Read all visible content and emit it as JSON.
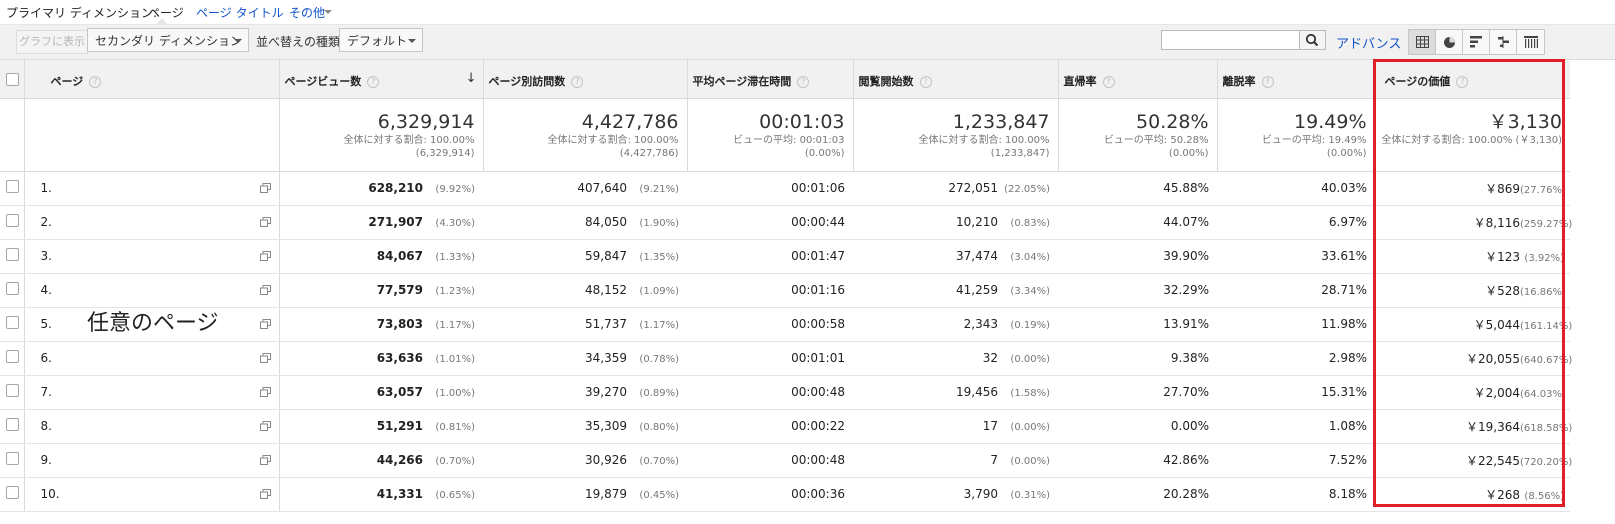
{
  "dimension_bar": {
    "label": "プライマリ ディメンション:",
    "current": "ページ",
    "links": [
      "ページ タイトル",
      "その他"
    ]
  },
  "toolbar": {
    "graph_button": "グラフに表示",
    "secondary_dimension": "セカンダリ ディメンション",
    "sort_label": "並べ替えの種類:",
    "sort_value": "デフォルト",
    "search_value": "",
    "advanced": "アドバンス",
    "view_buttons": [
      "table-view-icon",
      "pie-view-icon",
      "performance-view-icon",
      "comparison-view-icon",
      "pivot-view-icon"
    ]
  },
  "table": {
    "headers": {
      "page": "ページ",
      "pageviews": "ページビュー数",
      "unique": "ページ別訪問数",
      "avg_time": "平均ページ滞在時間",
      "entrances": "閲覧開始数",
      "bounce": "直帰率",
      "exit": "離脱率",
      "value": "ページの価値"
    },
    "totals": {
      "pageviews": {
        "big": "6,329,914",
        "sub1": "全体に対する割合: 100.00%",
        "sub2": "(6,329,914)"
      },
      "unique": {
        "big": "4,427,786",
        "sub1": "全体に対する割合: 100.00%",
        "sub2": "(4,427,786)"
      },
      "avg_time": {
        "big": "00:01:03",
        "sub1": "ビューの平均: 00:01:03",
        "sub2": "(0.00%)"
      },
      "entrances": {
        "big": "1,233,847",
        "sub1": "全体に対する割合: 100.00%",
        "sub2": "(1,233,847)"
      },
      "bounce": {
        "big": "50.28%",
        "sub1": "ビューの平均: 50.28%",
        "sub2": "(0.00%)"
      },
      "exit": {
        "big": "19.49%",
        "sub1": "ビューの平均: 19.49%",
        "sub2": "(0.00%)"
      },
      "value": {
        "big": "￥3,130",
        "sub1": "全体に対する割合: 100.00% (￥3,130)",
        "sub2": ""
      }
    },
    "rows": [
      {
        "idx": "1.",
        "pv": "628,210",
        "pv_pct": "(9.92%)",
        "up": "407,640",
        "up_pct": "(9.21%)",
        "time": "00:01:06",
        "ent": "272,051",
        "ent_pct": "(22.05%)",
        "bounce": "45.88%",
        "exit": "40.03%",
        "val": "￥869",
        "val_pct": "(27.76%)"
      },
      {
        "idx": "2.",
        "pv": "271,907",
        "pv_pct": "(4.30%)",
        "up": "84,050",
        "up_pct": "(1.90%)",
        "time": "00:00:44",
        "ent": "10,210",
        "ent_pct": "(0.83%)",
        "bounce": "44.07%",
        "exit": "6.97%",
        "val": "￥8,116",
        "val_pct": "(259.27%)"
      },
      {
        "idx": "3.",
        "pv": "84,067",
        "pv_pct": "(1.33%)",
        "up": "59,847",
        "up_pct": "(1.35%)",
        "time": "00:01:47",
        "ent": "37,474",
        "ent_pct": "(3.04%)",
        "bounce": "39.90%",
        "exit": "33.61%",
        "val": "￥123",
        "val_pct": "(3.92%)"
      },
      {
        "idx": "4.",
        "pv": "77,579",
        "pv_pct": "(1.23%)",
        "up": "48,152",
        "up_pct": "(1.09%)",
        "time": "00:01:16",
        "ent": "41,259",
        "ent_pct": "(3.34%)",
        "bounce": "32.29%",
        "exit": "28.71%",
        "val": "￥528",
        "val_pct": "(16.86%)"
      },
      {
        "idx": "5.",
        "pv": "73,803",
        "pv_pct": "(1.17%)",
        "up": "51,737",
        "up_pct": "(1.17%)",
        "time": "00:00:58",
        "ent": "2,343",
        "ent_pct": "(0.19%)",
        "bounce": "13.91%",
        "exit": "11.98%",
        "val": "￥5,044",
        "val_pct": "(161.14%)"
      },
      {
        "idx": "6.",
        "pv": "63,636",
        "pv_pct": "(1.01%)",
        "up": "34,359",
        "up_pct": "(0.78%)",
        "time": "00:01:01",
        "ent": "32",
        "ent_pct": "(0.00%)",
        "bounce": "9.38%",
        "exit": "2.98%",
        "val": "￥20,055",
        "val_pct": "(640.67%)"
      },
      {
        "idx": "7.",
        "pv": "63,057",
        "pv_pct": "(1.00%)",
        "up": "39,270",
        "up_pct": "(0.89%)",
        "time": "00:00:48",
        "ent": "19,456",
        "ent_pct": "(1.58%)",
        "bounce": "27.70%",
        "exit": "15.31%",
        "val": "￥2,004",
        "val_pct": "(64.03%)"
      },
      {
        "idx": "8.",
        "pv": "51,291",
        "pv_pct": "(0.81%)",
        "up": "35,309",
        "up_pct": "(0.80%)",
        "time": "00:00:22",
        "ent": "17",
        "ent_pct": "(0.00%)",
        "bounce": "0.00%",
        "exit": "1.08%",
        "val": "￥19,364",
        "val_pct": "(618.58%)"
      },
      {
        "idx": "9.",
        "pv": "44,266",
        "pv_pct": "(0.70%)",
        "up": "30,926",
        "up_pct": "(0.70%)",
        "time": "00:00:48",
        "ent": "7",
        "ent_pct": "(0.00%)",
        "bounce": "42.86%",
        "exit": "7.52%",
        "val": "￥22,545",
        "val_pct": "(720.20%)"
      },
      {
        "idx": "10.",
        "pv": "41,331",
        "pv_pct": "(0.65%)",
        "up": "19,879",
        "up_pct": "(0.45%)",
        "time": "00:00:36",
        "ent": "3,790",
        "ent_pct": "(0.31%)",
        "bounce": "20.28%",
        "exit": "8.18%",
        "val": "￥268",
        "val_pct": "(8.56%)"
      }
    ]
  },
  "overlay_label": "任意のページ",
  "colors": {
    "link": "#1155cc",
    "highlight": "#e31e26",
    "header_bg": "#f1f1f1"
  }
}
